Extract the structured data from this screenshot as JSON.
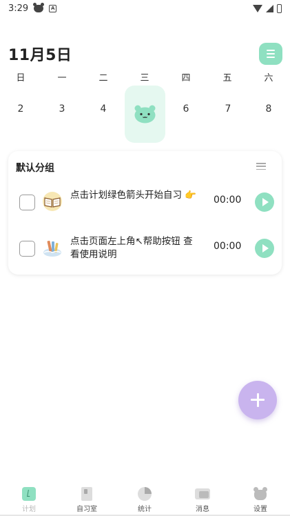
{
  "status_bar": {
    "time": "3:29",
    "icons": [
      "cat-icon",
      "a-icon",
      "wifi-icon",
      "signal-icon",
      "battery-icon"
    ]
  },
  "header": {
    "date_title": "11月5日",
    "help_icon": "menu-icon"
  },
  "week": {
    "days": [
      "日",
      "一",
      "二",
      "三",
      "四",
      "五",
      "六"
    ],
    "dates": [
      "2",
      "3",
      "4",
      "",
      "6",
      "7",
      "8"
    ],
    "today_index": 3,
    "today_icon": "bear-face-icon"
  },
  "group": {
    "title": "默认分组",
    "menu_icon": "list-menu-icon",
    "tasks": [
      {
        "text": "点击计划绿色箭头开始自习 👉",
        "time": "00:00",
        "icon": "open-book-icon"
      },
      {
        "text": "点击页面左上角↖帮助按钮 查看使用说明",
        "time": "00:00",
        "icon": "books-icon"
      }
    ]
  },
  "fab": {
    "icon": "plus-icon"
  },
  "bottom_nav": [
    {
      "label": "计划",
      "icon": "plan-icon",
      "active": true
    },
    {
      "label": "自习室",
      "icon": "study-room-icon",
      "active": false
    },
    {
      "label": "统计",
      "icon": "pie-chart-icon",
      "active": false
    },
    {
      "label": "消息",
      "icon": "chat-icon",
      "active": false
    },
    {
      "label": "设置",
      "icon": "bear-icon",
      "active": false
    }
  ],
  "colors": {
    "accent": "#8fe0c1",
    "today_bg": "#e5f8f0",
    "fab": "#c9b4ee"
  }
}
